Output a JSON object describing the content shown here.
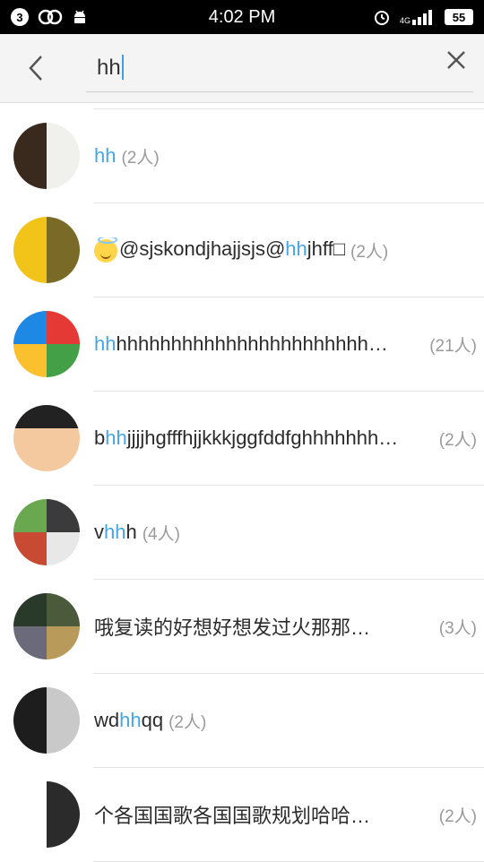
{
  "status_bar": {
    "notification_badge": "3",
    "time": "4:02 PM",
    "network": "4G",
    "battery": "55"
  },
  "search": {
    "query": "hh"
  },
  "results": [
    {
      "parts": [
        {
          "t": "hh",
          "h": true
        }
      ],
      "count": "(2人)",
      "count_right": false
    },
    {
      "emoji": true,
      "parts": [
        {
          "t": "@sjskondjhajjsjs@",
          "h": false
        },
        {
          "t": "hh",
          "h": true
        },
        {
          "t": "jhff□",
          "h": false
        }
      ],
      "count": "(2人)",
      "count_right": false
    },
    {
      "parts": [
        {
          "t": "hh",
          "h": true
        },
        {
          "t": "hhhhhhhhhhhhhhhhhhhhhhh…",
          "h": false
        }
      ],
      "count": "(21人)",
      "count_right": true
    },
    {
      "parts": [
        {
          "t": "b",
          "h": false
        },
        {
          "t": "hh",
          "h": true
        },
        {
          "t": "jjjjhgfffhjjkkkjggfddfghhhhhhh…",
          "h": false
        }
      ],
      "count": "(2人)",
      "count_right": true
    },
    {
      "parts": [
        {
          "t": "v",
          "h": false
        },
        {
          "t": "hh",
          "h": true
        },
        {
          "t": "h",
          "h": false
        }
      ],
      "count": "(4人)",
      "count_right": false
    },
    {
      "parts": [
        {
          "t": "哦复读的好想好想发过火那那…",
          "h": false
        }
      ],
      "count": "(3人)",
      "count_right": true
    },
    {
      "parts": [
        {
          "t": "wd",
          "h": false
        },
        {
          "t": "hh",
          "h": true
        },
        {
          "t": "qq",
          "h": false
        }
      ],
      "count": "(2人)",
      "count_right": false
    },
    {
      "parts": [
        {
          "t": "个各国国歌各国国歌规划哈哈…",
          "h": false
        }
      ],
      "count": "(2人)",
      "count_right": true
    }
  ],
  "colors": {
    "highlight": "#44a6e6",
    "count": "#9a9a9a",
    "caret": "#3aa0e8"
  },
  "icons": {
    "back": "chevron-left-icon",
    "clear": "close-icon"
  }
}
